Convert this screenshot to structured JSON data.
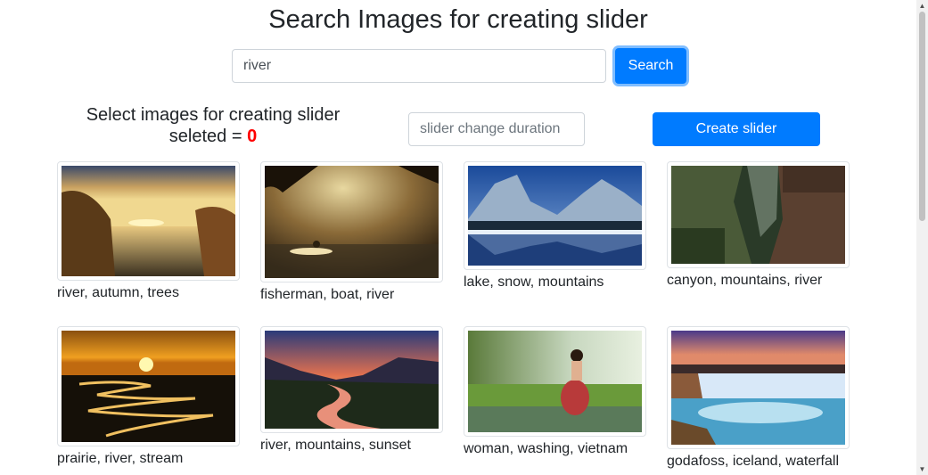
{
  "header": {
    "title": "Search Images for creating slider"
  },
  "search": {
    "value": "river",
    "button_label": "Search"
  },
  "selection": {
    "prompt": "Select images for creating slider",
    "count_label": "seleted =",
    "count": "0"
  },
  "slider": {
    "duration_placeholder": "slider change duration",
    "create_label": "Create slider"
  },
  "images": [
    {
      "caption": "river, autumn, trees"
    },
    {
      "caption": "fisherman, boat, river"
    },
    {
      "caption": "lake, snow, mountains"
    },
    {
      "caption": "canyon, mountains, river"
    },
    {
      "caption": "prairie, river, stream"
    },
    {
      "caption": "river, mountains, sunset"
    },
    {
      "caption": "woman, washing, vietnam"
    },
    {
      "caption": "godafoss, iceland, waterfall"
    }
  ],
  "colors": {
    "primary": "#007bff",
    "count": "#ff0000"
  },
  "scrollbar": {
    "up_icon": "▲",
    "down_icon": "▼"
  }
}
